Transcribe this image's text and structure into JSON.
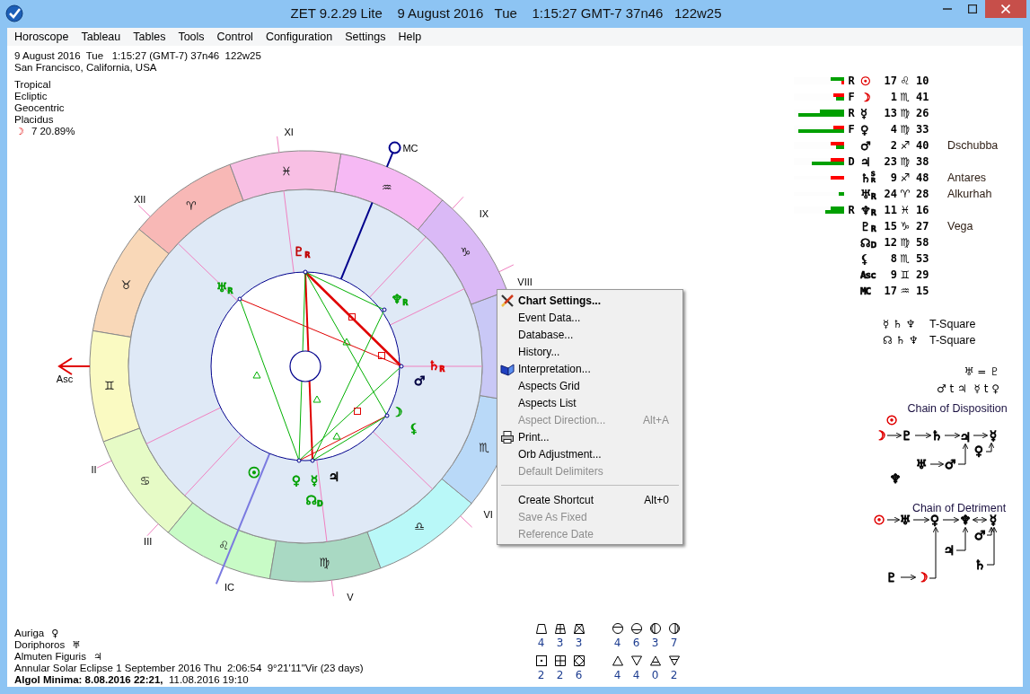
{
  "window": {
    "title": "ZET 9.2.29 Lite    9 August 2016   Tue    1:15:27 GMT-7 37n46   122w25"
  },
  "menu_bar": [
    {
      "label": "Horoscope"
    },
    {
      "label": "Tableau"
    },
    {
      "label": "Tables"
    },
    {
      "label": "Tools"
    },
    {
      "label": "Control"
    },
    {
      "label": "Configuration"
    },
    {
      "label": "Settings"
    },
    {
      "label": "Help"
    }
  ],
  "event": {
    "date_line": "9 August 2016  Tue   1:15:27 (GMT-7) 37n46  122w25",
    "place": "San Francisco, California, USA"
  },
  "chart_settings": [
    "Tropical",
    "Ecliptic",
    "Geocentric",
    "Placidus"
  ],
  "moon_phase": {
    "glyph": "☽",
    "text": "7 20.89%"
  },
  "wheel": {
    "signs": [
      {
        "glyph": "♈",
        "color": "#f8b8b6"
      },
      {
        "glyph": "♉",
        "color": "#f9d8b8"
      },
      {
        "glyph": "♊",
        "color": "#fafac2"
      },
      {
        "glyph": "♋",
        "color": "#e6fbc6"
      },
      {
        "glyph": "♌",
        "color": "#c8fbc6"
      },
      {
        "glyph": "♍",
        "color": "#a9d9c3"
      },
      {
        "glyph": "♎",
        "color": "#b9f8f8"
      },
      {
        "glyph": "♏",
        "color": "#b9d9f8"
      },
      {
        "color": "#c9c8f6"
      },
      {
        "glyph": "♑",
        "color": "#dab9f6"
      },
      {
        "glyph": "♒",
        "color": "#f6b9f4"
      },
      {
        "glyph": "♓",
        "color": "#f8bfe4"
      }
    ],
    "houses": [
      {
        "label": "Asc"
      },
      {
        "label": "II"
      },
      {
        "label": "III"
      },
      {
        "label": "IC"
      },
      {
        "label": "V"
      },
      {
        "label": "VI"
      },
      {
        "label": "VIII"
      },
      {
        "label": "IX"
      },
      {
        "label": "MC"
      },
      {
        "label": "XI"
      },
      {
        "label": "XII"
      }
    ],
    "planets": [
      {
        "glyph": "♇",
        "sub": "R",
        "color": "#c00000"
      },
      {
        "glyph": "♅",
        "sub": "R",
        "color": "#00a000"
      },
      {
        "glyph": "♆",
        "sub": "R",
        "color": "#00a000"
      },
      {
        "glyph": "♄",
        "sub": "R",
        "color": "#e00000"
      },
      {
        "glyph": "♂",
        "color": "#000040"
      },
      {
        "glyph": "☽",
        "color": "#00a000"
      },
      {
        "glyph": "⚸",
        "color": "#00a000"
      },
      {
        "glyph": "☉",
        "color": "#00a000"
      },
      {
        "glyph": "♀",
        "color": "#00a000"
      },
      {
        "glyph": "☿",
        "color": "#00a000"
      },
      {
        "glyph": "♃",
        "color": "#000000"
      },
      {
        "glyph": "☊",
        "sub": "D",
        "color": "#00a000"
      }
    ]
  },
  "positions": [
    {
      "flag": "R",
      "glyph": "☉",
      "color": "#e00000",
      "degree": "17",
      "sign": "♌",
      "minutes": "10",
      "bars": [
        {
          "color": "#00a000",
          "level": 0.27
        },
        {
          "color": "#ff0000",
          "level": 0.05
        }
      ]
    },
    {
      "flag": "F",
      "glyph": "☽",
      "color": "#e00000",
      "degree": "1",
      "sign": "♏",
      "minutes": "41",
      "bars": [
        {
          "color": "#ff0000",
          "level": 0.21
        },
        {
          "color": "#00a000",
          "level": 0.16
        }
      ]
    },
    {
      "flag": "R",
      "glyph": "☿",
      "color": "#000000",
      "degree": "13",
      "sign": "♍",
      "minutes": "26",
      "bars": [
        {
          "color": "#00a000",
          "level": 0.48
        },
        {
          "color": "#00a000",
          "level": 0.91
        }
      ]
    },
    {
      "flag": "F",
      "glyph": "♀",
      "color": "#000000",
      "degree": "4",
      "sign": "♍",
      "minutes": "33",
      "bars": [
        {
          "color": "#ff0000",
          "level": 0.21
        },
        {
          "color": "#00a000",
          "level": 0.91
        }
      ]
    },
    {
      "glyph": "♂",
      "color": "#000000",
      "degree": "2",
      "sign": "♐",
      "minutes": "40",
      "star": "Dschubba",
      "bars": [
        {
          "color": "#ff0000",
          "level": 0.27
        },
        {
          "color": "#00a000",
          "level": 0.16
        }
      ]
    },
    {
      "flag": "D",
      "glyph": "♃",
      "color": "#000000",
      "degree": "23",
      "sign": "♍",
      "minutes": "38",
      "bars": [
        {
          "color": "#ff0000",
          "level": 0.27
        },
        {
          "color": "#00a000",
          "level": 0.64
        }
      ]
    },
    {
      "glyph": "♄",
      "sup": "S",
      "sub": "R",
      "color": "#000000",
      "degree": "9",
      "sign": "♐",
      "minutes": "48",
      "star": "Antares",
      "bars": [
        {
          "color": "#ff0000",
          "level": 0.27
        }
      ]
    },
    {
      "glyph": "♅",
      "sub": "R",
      "color": "#000000",
      "degree": "24",
      "sign": "♈",
      "minutes": "28",
      "star": "Alkurhah",
      "bars": [
        {
          "color": "#00a000",
          "level": 0.11
        }
      ]
    },
    {
      "flag": "R",
      "glyph": "♆",
      "sub": "R",
      "color": "#000000",
      "degree": "11",
      "sign": "♓",
      "minutes": "16",
      "bars": [
        {
          "color": "#00a000",
          "level": 0.27
        },
        {
          "color": "#00a000",
          "level": 0.38
        }
      ]
    },
    {
      "glyph": "♇",
      "sub": "R",
      "color": "#000000",
      "degree": "15",
      "sign": "♑",
      "minutes": "27",
      "star": "Vega"
    },
    {
      "glyph": "☊",
      "sub": "D",
      "color": "#000000",
      "degree": "12",
      "sign": "♍",
      "minutes": "58"
    },
    {
      "glyph": "⚸",
      "color": "#000000",
      "degree": "8",
      "sign": "♏",
      "minutes": "53"
    },
    {
      "glyph": "Asc",
      "color": "#000000",
      "degree": "9",
      "sign": "♊",
      "minutes": "29"
    },
    {
      "glyph": "MC",
      "color": "#000000",
      "degree": "17",
      "sign": "♒",
      "minutes": "15"
    }
  ],
  "t_squares": [
    {
      "glyphs": "☿ ♄ ♆",
      "label": "T-Square"
    },
    {
      "glyphs": "☊ ♄ ♆",
      "label": "T-Square"
    }
  ],
  "receptions": [
    "♅ = ♇",
    "♂ t ♃  ☿ t ♀"
  ],
  "chain_of_disposition": {
    "title": "Chain of Disposition",
    "nodes": [
      {
        "glyph": "☉",
        "color": "#e00000"
      },
      {
        "glyph": "☽",
        "color": "#e00000"
      },
      {
        "glyph": "♇",
        "color": "#000000"
      },
      {
        "glyph": "♄",
        "color": "#000000"
      },
      {
        "glyph": "♃",
        "color": "#000000"
      },
      {
        "glyph": "☿",
        "color": "#000000"
      },
      {
        "glyph": "♀",
        "color": "#000000"
      },
      {
        "glyph": "♅",
        "color": "#000000"
      },
      {
        "glyph": "♂",
        "color": "#000000"
      },
      {
        "glyph": "♆",
        "color": "#000000"
      }
    ]
  },
  "chain_of_detriment": {
    "title": "Chain of Detriment",
    "nodes": [
      {
        "glyph": "☉",
        "color": "#e00000"
      },
      {
        "glyph": "♅",
        "color": "#000000"
      },
      {
        "glyph": "♀",
        "color": "#000000"
      },
      {
        "glyph": "♆",
        "color": "#000000"
      },
      {
        "glyph": "☿",
        "color": "#000000"
      },
      {
        "glyph": "♂",
        "color": "#000000"
      },
      {
        "glyph": "♃",
        "color": "#000000"
      },
      {
        "glyph": "♄",
        "color": "#000000"
      },
      {
        "glyph": "♇",
        "color": "#000000"
      },
      {
        "glyph": "☽",
        "color": "#e00000"
      }
    ]
  },
  "notes": [
    {
      "text": "Auriga",
      "glyph": "♀"
    },
    {
      "text": "Doriphoros",
      "glyph": "♅"
    },
    {
      "text": "Almuten Figuris",
      "glyph": "♃"
    }
  ],
  "eclipse": "Annular Solar Eclipse 1 September 2016 Thu  2:06:54  9°21'11\"Vir (23 days)",
  "algol": "**Algol Minima: 8.08.2016 22:21,**  11.08.2016 19:10",
  "figures": [
    {
      "kind": "trapezoid",
      "count": "4"
    },
    {
      "kind": "kite",
      "count": "3"
    },
    {
      "kind": "envelope",
      "count": "3"
    },
    {
      "kind": "dotbox",
      "count": "2"
    },
    {
      "kind": "grid",
      "count": "2"
    },
    {
      "kind": "diamond",
      "count": "6"
    }
  ],
  "phases": [
    {
      "kind": "uppercircle",
      "count": "4"
    },
    {
      "kind": "lowercircle",
      "count": "6"
    },
    {
      "kind": "leftcircle",
      "count": "3"
    },
    {
      "kind": "rightcircle",
      "count": "7"
    },
    {
      "kind": "uptriangle",
      "count": "4"
    },
    {
      "kind": "downtriangle",
      "count": "4"
    },
    {
      "kind": "upbartriangle",
      "count": "0"
    },
    {
      "kind": "downbartriangle",
      "count": "2"
    }
  ],
  "context_menu": [
    {
      "kind": "item",
      "label": "Chart Settings...",
      "default": true,
      "disabled": false
    },
    {
      "kind": "item",
      "label": "Event Data...",
      "default": false,
      "disabled": false
    },
    {
      "kind": "item",
      "label": "Database...",
      "default": false,
      "disabled": false
    },
    {
      "kind": "item",
      "label": "History...",
      "default": false,
      "disabled": false
    },
    {
      "kind": "item",
      "label": "Interpretation...",
      "default": false,
      "disabled": false
    },
    {
      "kind": "item",
      "label": "Aspects Grid",
      "default": false,
      "disabled": false
    },
    {
      "kind": "item",
      "label": "Aspects List",
      "default": false,
      "disabled": false
    },
    {
      "kind": "item",
      "label": "Aspect Direction...",
      "shortcut": "Alt+A",
      "default": false,
      "disabled": true
    },
    {
      "kind": "item",
      "label": "Print...",
      "default": false,
      "disabled": false
    },
    {
      "kind": "item",
      "label": "Orb Adjustment...",
      "default": false,
      "disabled": false
    },
    {
      "kind": "item",
      "label": "Default Delimiters",
      "default": false,
      "disabled": true
    },
    {
      "kind": "separator"
    },
    {
      "kind": "item",
      "label": "Create Shortcut",
      "shortcut": "Alt+0",
      "default": false,
      "disabled": false
    },
    {
      "kind": "item",
      "label": "Save As Fixed",
      "default": false,
      "disabled": true
    },
    {
      "kind": "item",
      "label": "Reference Date",
      "default": false,
      "disabled": true
    }
  ]
}
